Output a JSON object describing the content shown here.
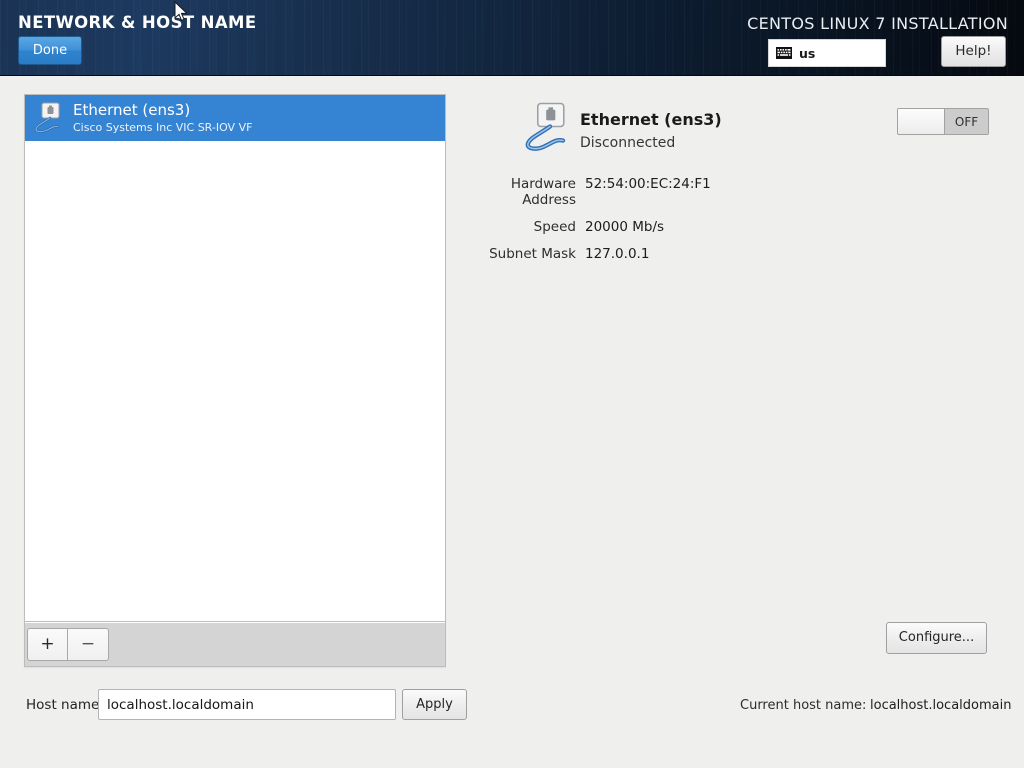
{
  "header": {
    "title": "NETWORK & HOST NAME",
    "done_label": "Done",
    "install_label": "CENTOS LINUX 7 INSTALLATION",
    "keyboard_layout": "us",
    "keyboard_icon": "keyboard-icon",
    "help_label": "Help!"
  },
  "device_list": {
    "items": [
      {
        "title": "Ethernet (ens3)",
        "subtitle": "Cisco Systems Inc VIC SR-IOV VF",
        "icon": "wired-unplugged-icon",
        "selected": true
      }
    ],
    "toolbar": {
      "add_label": "+",
      "remove_label": "−"
    }
  },
  "details": {
    "icon": "wired-unplugged-icon",
    "name": "Ethernet (ens3)",
    "status": "Disconnected",
    "fields": [
      {
        "label": "Hardware Address",
        "value": "52:54:00:EC:24:F1"
      },
      {
        "label": "Speed",
        "value": "20000 Mb/s"
      },
      {
        "label": "Subnet Mask",
        "value": "127.0.0.1"
      }
    ],
    "toggle_state": "OFF",
    "configure_label": "Configure..."
  },
  "footer": {
    "hostname_label": "Host name:",
    "hostname_value": "localhost.localdomain",
    "hostname_placeholder": "localhost.localdomain",
    "apply_label": "Apply",
    "current_hostname_label": "Current host name:",
    "current_hostname_value": "localhost.localdomain"
  },
  "colors": {
    "accent_blue": "#3584d4",
    "header_dark": "#0a1625",
    "done_blue": "#3e91d8",
    "panel_bg": "#efefee"
  }
}
